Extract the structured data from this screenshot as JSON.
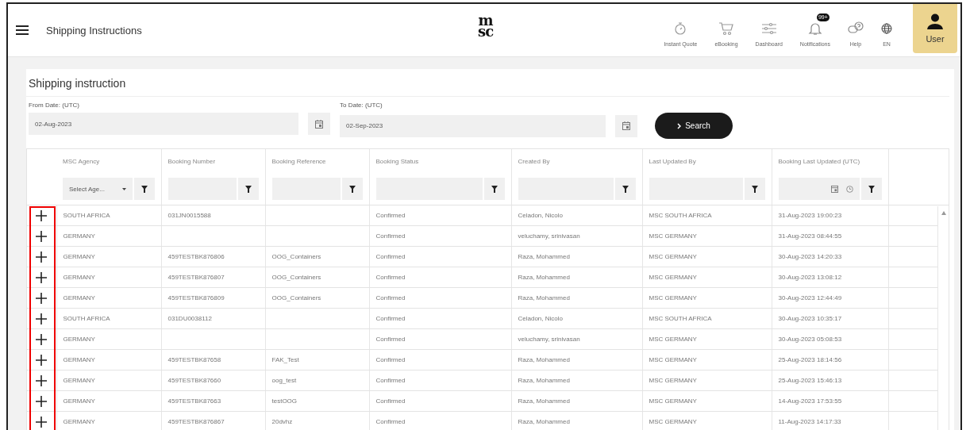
{
  "header": {
    "title": "Shipping Instructions",
    "logo_lines": [
      "m",
      "sc"
    ],
    "nav": [
      {
        "kind": "stopwatch",
        "label": "Instant Quote"
      },
      {
        "kind": "cart",
        "label": "eBooking"
      },
      {
        "kind": "sliders",
        "label": "Dashboard"
      },
      {
        "kind": "bell",
        "label": "Notifications",
        "badge": "99+"
      },
      {
        "kind": "help",
        "label": "Help"
      },
      {
        "kind": "globe",
        "label": "EN"
      }
    ],
    "user": {
      "label": "User"
    }
  },
  "panel": {
    "title": "Shipping instruction",
    "from": {
      "label": "From Date: (UTC)",
      "value": "02-Aug-2023"
    },
    "to": {
      "label": "To Date: (UTC)",
      "value": "02-Sep-2023"
    },
    "search_button": "Search"
  },
  "table": {
    "columns": [
      {
        "label": "MSC Agency",
        "kind": "select",
        "placeholder": "Select Age..."
      },
      {
        "label": "Booking Number",
        "kind": "text"
      },
      {
        "label": "Booking Reference",
        "kind": "text"
      },
      {
        "label": "Booking Status",
        "kind": "text"
      },
      {
        "label": "Created By",
        "kind": "text"
      },
      {
        "label": "Last Updated By",
        "kind": "text"
      },
      {
        "label": "Booking Last Updated (UTC)",
        "kind": "datetime"
      }
    ],
    "rows": [
      [
        "SOUTH AFRICA",
        "031JN0015588",
        "",
        "Confirmed",
        "Celadon, Nicolo",
        "MSC SOUTH AFRICA",
        "31-Aug-2023 19:00:23"
      ],
      [
        "GERMANY",
        "",
        "",
        "Confirmed",
        "veluchamy, srinivasan",
        "MSC GERMANY",
        "31-Aug-2023 08:44:55"
      ],
      [
        "GERMANY",
        "459TESTBK876806",
        "OOG_Containers",
        "Confirmed",
        "Raza, Mohammed",
        "MSC GERMANY",
        "30-Aug-2023 14:20:33"
      ],
      [
        "GERMANY",
        "459TESTBK876807",
        "OOG_Containers",
        "Confirmed",
        "Raza, Mohammed",
        "MSC GERMANY",
        "30-Aug-2023 13:08:12"
      ],
      [
        "GERMANY",
        "459TESTBK876809",
        "OOG_Containers",
        "Confirmed",
        "Raza, Mohammed",
        "MSC GERMANY",
        "30-Aug-2023 12:44:49"
      ],
      [
        "SOUTH AFRICA",
        "031DU0038112",
        "",
        "Confirmed",
        "Celadon, Nicolo",
        "MSC SOUTH AFRICA",
        "30-Aug-2023 10:35:17"
      ],
      [
        "GERMANY",
        "",
        "",
        "Confirmed",
        "veluchamy, srinivasan",
        "MSC GERMANY",
        "30-Aug-2023 05:08:53"
      ],
      [
        "GERMANY",
        "459TESTBK87658",
        "FAK_Test",
        "Confirmed",
        "Raza, Mohammed",
        "MSC GERMANY",
        "25-Aug-2023 18:14:56"
      ],
      [
        "GERMANY",
        "459TESTBK87660",
        "oog_test",
        "Confirmed",
        "Raza, Mohammed",
        "MSC GERMANY",
        "25-Aug-2023 15:46:13"
      ],
      [
        "GERMANY",
        "459TESTBK87663",
        "testOOG",
        "Confirmed",
        "Raza, Mohammed",
        "MSC GERMANY",
        "14-Aug-2023 17:53:55"
      ],
      [
        "GERMANY",
        "459TESTBK876867",
        "20dvhz",
        "Confirmed",
        "Raza, Mohammed",
        "MSC GERMANY",
        "11-Aug-2023 14:17:33"
      ]
    ]
  }
}
